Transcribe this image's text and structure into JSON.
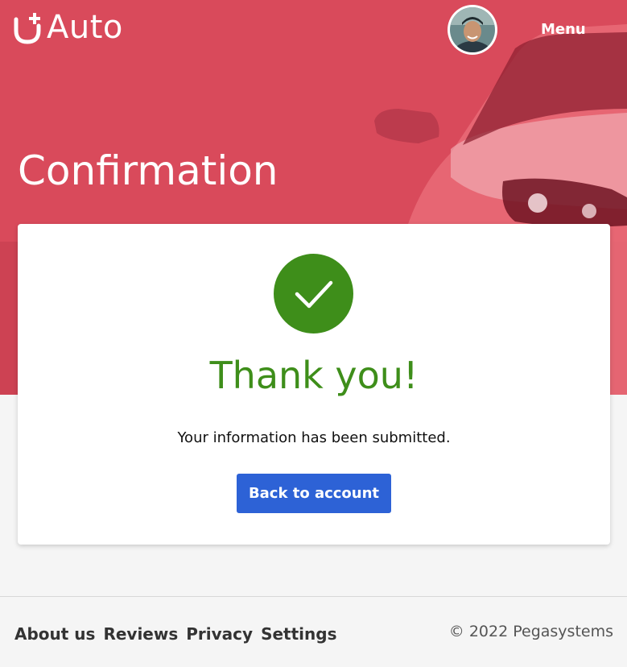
{
  "brand": {
    "logo_text": "Auto",
    "accent_color": "#d94a5b"
  },
  "header": {
    "menu_label": "Menu",
    "avatar_icon": "user-avatar"
  },
  "hero": {
    "title": "Confirmation"
  },
  "confirmation": {
    "icon": "checkmark-icon",
    "heading": "Thank you!",
    "message": "Your information has been submitted.",
    "button_label": "Back to account",
    "success_color": "#3e8e1a",
    "button_color": "#2d62d6"
  },
  "footer": {
    "links": [
      "About us",
      "Reviews",
      "Privacy",
      "Settings"
    ],
    "copyright": "© 2022 Pegasystems"
  }
}
